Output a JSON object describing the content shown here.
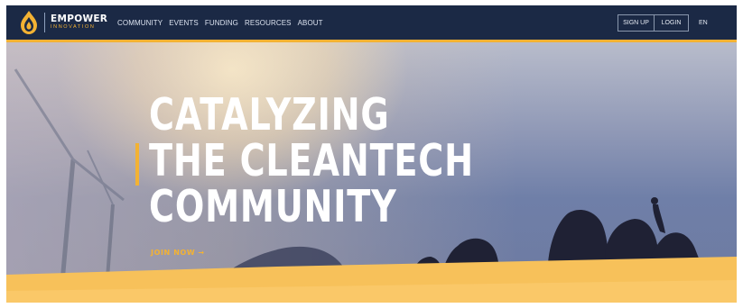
{
  "header": {
    "logo": {
      "word": "EMPOWER",
      "sub": "INNOVATION"
    },
    "menu": [
      {
        "label": "COMMUNITY"
      },
      {
        "label": "EVENTS"
      },
      {
        "label": "FUNDING"
      },
      {
        "label": "RESOURCES"
      },
      {
        "label": "ABOUT"
      }
    ],
    "signup_label": "SIGN UP",
    "login_label": "LOGIN",
    "language_label": "EN"
  },
  "hero": {
    "headline_lines": [
      "CATALYZING",
      "THE CLEANTECH",
      "COMMUNITY"
    ],
    "cta_label": "JOIN NOW",
    "cta_arrow": "→"
  },
  "colors": {
    "nav_background": "#1b2945",
    "accent": "#f3b233",
    "headline": "#ffffff"
  }
}
